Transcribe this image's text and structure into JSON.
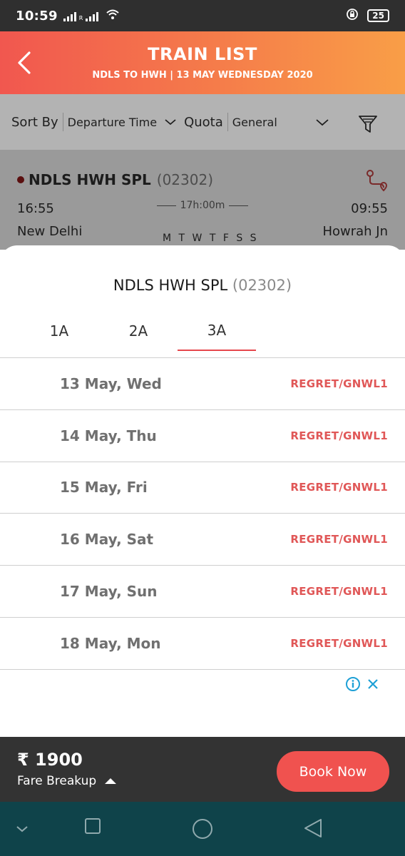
{
  "status_bar": {
    "time": "10:59",
    "network_label": "R",
    "battery": "25"
  },
  "header": {
    "title": "TRAIN LIST",
    "subtitle": "NDLS TO HWH | 13 MAY WEDNESDAY 2020"
  },
  "sort_bar": {
    "sort_label": "Sort By",
    "sort_value": "Departure Time",
    "quota_label": "Quota",
    "quota_value": "General"
  },
  "train_card": {
    "name": "NDLS HWH SPL",
    "number": "(02302)",
    "departure_time": "16:55",
    "arrival_time": "09:55",
    "duration": "17h:00m",
    "from_station": "New Delhi",
    "to_station": "Howrah Jn",
    "days": "M T W T F S S"
  },
  "sheet": {
    "train_name": "NDLS HWH SPL",
    "train_number": "(02302)",
    "tabs": [
      {
        "label": "1A"
      },
      {
        "label": "2A"
      },
      {
        "label": "3A"
      }
    ],
    "active_tab": "3A",
    "availability": [
      {
        "date": "13 May, Wed",
        "status": "REGRET/GNWL1"
      },
      {
        "date": "14 May, Thu",
        "status": "REGRET/GNWL1"
      },
      {
        "date": "15 May, Fri",
        "status": "REGRET/GNWL1"
      },
      {
        "date": "16 May, Sat",
        "status": "REGRET/GNWL1"
      },
      {
        "date": "17 May, Sun",
        "status": "REGRET/GNWL1"
      },
      {
        "date": "18 May, Mon",
        "status": "REGRET/GNWL1"
      }
    ]
  },
  "footer": {
    "fare": "₹ 1900",
    "fare_breakup_label": "Fare Breakup",
    "book_label": "Book Now"
  },
  "colors": {
    "accent": "#f0524f",
    "status_red": "#e05757",
    "header_start": "#f1574f",
    "header_end": "#f99e47",
    "nav_bg": "#0f434a"
  },
  "icons": [
    "back-arrow-icon",
    "chevron-down-icon",
    "filter-funnel-icon",
    "route-pin-icon",
    "ad-info-icon",
    "ad-close-icon",
    "caret-up-icon",
    "nav-down-icon",
    "nav-recents-icon",
    "nav-home-icon",
    "nav-back-icon"
  ]
}
